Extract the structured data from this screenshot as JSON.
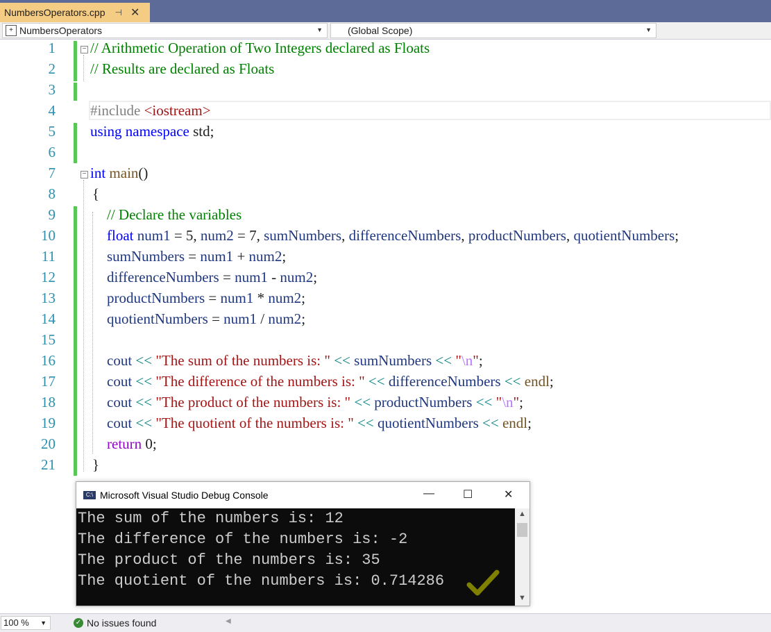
{
  "tab": {
    "filename": "NumbersOperators.cpp",
    "pin_glyph": "⊣",
    "close_glyph": "✕"
  },
  "navbar": {
    "project": "NumbersOperators",
    "scope": "(Global Scope)"
  },
  "line_numbers": [
    "1",
    "2",
    "3",
    "4",
    "5",
    "6",
    "7",
    "8",
    "9",
    "10",
    "11",
    "12",
    "13",
    "14",
    "15",
    "16",
    "17",
    "18",
    "19",
    "20",
    "21"
  ],
  "code": {
    "l1": "// Arithmetic Operation of Two Integers declared as Floats",
    "l2": "// Results are declared as Floats",
    "l4_pre": "#include ",
    "l4_inc": "<iostream>",
    "l5_kw": "using namespace",
    "l5_rest": " std;",
    "l7_kw": "int",
    "l7_fn": " main",
    "l7_rest": "()",
    "l8": "{",
    "l9": "// Declare the variables",
    "l10_kw": "float",
    "l10_a": " num1",
    "l10_b": " = 5, ",
    "l10_c": "num2",
    "l10_d": " = 7, ",
    "l10_e": "sumNumbers",
    "l10_f": ", ",
    "l10_g": "differenceNumbers",
    "l10_h": ", ",
    "l10_i": "productNumbers",
    "l10_j": ", ",
    "l10_k": "quotientNumbers",
    "l10_l": ";",
    "l11_a": "sumNumbers",
    "l11_b": " = ",
    "l11_c": "num1",
    "l11_d": " + ",
    "l11_e": "num2",
    "l11_f": ";",
    "l12_a": "differenceNumbers",
    "l12_b": " = ",
    "l12_c": "num1",
    "l12_d": " - ",
    "l12_e": "num2",
    "l12_f": ";",
    "l13_a": "productNumbers",
    "l13_b": " = ",
    "l13_c": "num1",
    "l13_d": " * ",
    "l13_e": "num2",
    "l13_f": ";",
    "l14_a": "quotientNumbers",
    "l14_b": " = ",
    "l14_c": "num1",
    "l14_d": " / ",
    "l14_e": "num2",
    "l14_f": ";",
    "cout": "cout",
    "op": " << ",
    "l16_str": "\"The sum of the numbers is: \"",
    "l16_var": "sumNumbers",
    "q": "\"",
    "esc": "\\n",
    "semi": ";",
    "l17_str": "\"The difference of the numbers is: \"",
    "l17_var": "differenceNumbers",
    "endl": "endl",
    "l18_str": "\"The product of the numbers is: \"",
    "l18_var": "productNumbers",
    "l19_str": "\"The quotient of the numbers is: \"",
    "l19_var": "quotientNumbers",
    "l20_kw": "return",
    "l20_rest": " 0;",
    "l21": "}"
  },
  "console": {
    "title": "Microsoft Visual Studio Debug Console",
    "icon_text": "C:\\",
    "minimize": "—",
    "maximize": "☐",
    "close": "✕",
    "lines": [
      "The sum of the numbers is: 12",
      "The difference of the numbers is: -2",
      "The product of the numbers is: 35",
      "The quotient of the numbers is: 0.714286"
    ],
    "checkmark_color": "#808000"
  },
  "status": {
    "zoom": "100 %",
    "issues": "No issues found"
  },
  "colors": {
    "tabstrip": "#5d6b99",
    "active_tab": "#f5cc84",
    "change_bar": "#57c757",
    "line_number": "#2b91af"
  }
}
